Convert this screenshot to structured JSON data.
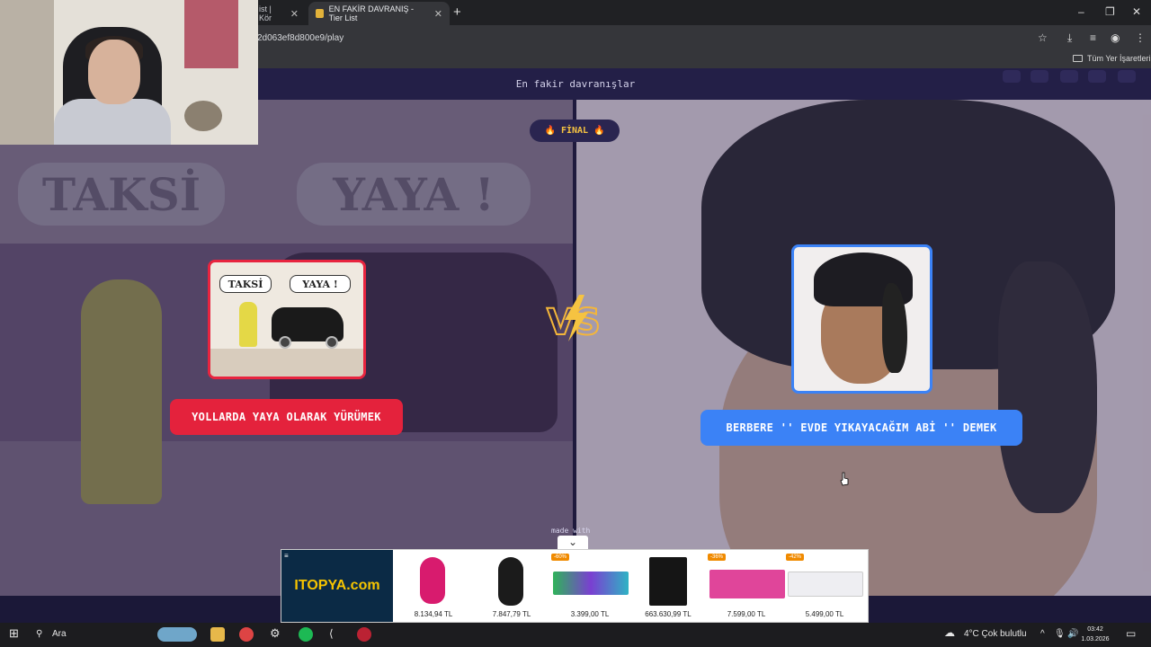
{
  "browser": {
    "tabs": [
      {
        "label": "ist | Kör"
      },
      {
        "label": "EN FAKİR DAVRANIŞ - Tier List"
      }
    ],
    "new_tab": "+",
    "url": "2d063ef8d800e9/play",
    "bookmarks_label": "Tüm Yer İşaretleri",
    "window_controls": [
      "–",
      "❐",
      "✕"
    ]
  },
  "page": {
    "subtitle": "En fakir davranışlar",
    "round_badge": "FİNAL",
    "left_option": {
      "label": "YOLLARDA YAYA OLARAK YÜRÜMEK",
      "image_signs": [
        "TAKSİ",
        "YAYA !"
      ],
      "accent": "#e4223c"
    },
    "right_option": {
      "label": "BERBERE '' EVDE YIKAYACAĞIM ABİ '' DEMEK",
      "accent": "#3b82f6"
    },
    "vs_text": "VS",
    "background_signs": [
      "TAKSİ",
      "YAYA !"
    ],
    "made_with": "made with"
  },
  "ad": {
    "brand": "ITOPYA.com",
    "products": [
      {
        "price": "8.134,94 TL",
        "discount": "",
        "icon": "mouse-pink"
      },
      {
        "price": "7.847,79 TL",
        "discount": "",
        "icon": "mouse-black"
      },
      {
        "price": "3.399,00 TL",
        "discount": "-60%",
        "icon": "keyboard-rgb"
      },
      {
        "price": "663.630,99 TL",
        "discount": "",
        "icon": "pc-case"
      },
      {
        "price": "7.599,00 TL",
        "discount": "-36%",
        "icon": "keyboard-pink"
      },
      {
        "price": "5.499,00 TL",
        "discount": "-42%",
        "icon": "keyboard-white"
      }
    ]
  },
  "taskbar": {
    "search": "Ara",
    "weather": "4°C  Çok bulutlu",
    "time": "03:42",
    "date": "1.03.2026"
  }
}
